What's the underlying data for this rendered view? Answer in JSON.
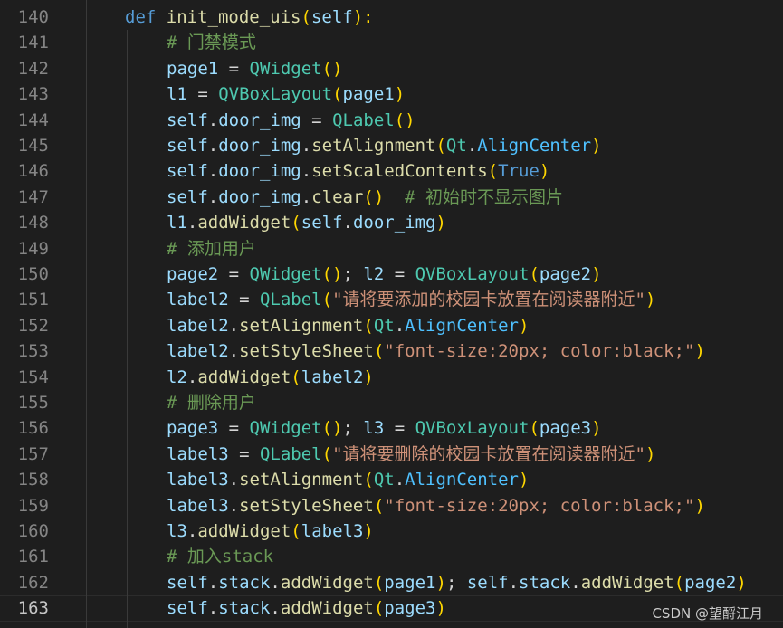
{
  "editor": {
    "watermark": "CSDN @望酹江月",
    "current_line": 163,
    "lines": [
      {
        "n": 140,
        "tokens": [
          [
            "kw",
            "def "
          ],
          [
            "fn",
            "init_mode_uis"
          ],
          [
            "pr",
            "("
          ],
          [
            "var",
            "self"
          ],
          [
            "pr",
            "):"
          ]
        ]
      },
      {
        "n": 141,
        "tokens": [
          [
            "cm",
            "# 门禁模式"
          ]
        ]
      },
      {
        "n": 142,
        "tokens": [
          [
            "var",
            "page1"
          ],
          [
            "pl",
            " = "
          ],
          [
            "cls",
            "QWidget"
          ],
          [
            "pr",
            "()"
          ]
        ]
      },
      {
        "n": 143,
        "tokens": [
          [
            "var",
            "l1"
          ],
          [
            "pl",
            " = "
          ],
          [
            "cls",
            "QVBoxLayout"
          ],
          [
            "pr",
            "("
          ],
          [
            "var",
            "page1"
          ],
          [
            "pr",
            ")"
          ]
        ]
      },
      {
        "n": 144,
        "tokens": [
          [
            "var",
            "self"
          ],
          [
            "pl",
            "."
          ],
          [
            "var",
            "door_img"
          ],
          [
            "pl",
            " = "
          ],
          [
            "cls",
            "QLabel"
          ],
          [
            "pr",
            "()"
          ]
        ]
      },
      {
        "n": 145,
        "tokens": [
          [
            "var",
            "self"
          ],
          [
            "pl",
            "."
          ],
          [
            "var",
            "door_img"
          ],
          [
            "pl",
            "."
          ],
          [
            "fn",
            "setAlignment"
          ],
          [
            "pr",
            "("
          ],
          [
            "cls",
            "Qt"
          ],
          [
            "pl",
            "."
          ],
          [
            "cn",
            "AlignCenter"
          ],
          [
            "pr",
            ")"
          ]
        ]
      },
      {
        "n": 146,
        "tokens": [
          [
            "var",
            "self"
          ],
          [
            "pl",
            "."
          ],
          [
            "var",
            "door_img"
          ],
          [
            "pl",
            "."
          ],
          [
            "fn",
            "setScaledContents"
          ],
          [
            "pr",
            "("
          ],
          [
            "const",
            "True"
          ],
          [
            "pr",
            ")"
          ]
        ]
      },
      {
        "n": 147,
        "tokens": [
          [
            "var",
            "self"
          ],
          [
            "pl",
            "."
          ],
          [
            "var",
            "door_img"
          ],
          [
            "pl",
            "."
          ],
          [
            "fn",
            "clear"
          ],
          [
            "pr",
            "()"
          ],
          [
            "pl",
            "  "
          ],
          [
            "cm",
            "# 初始时不显示图片"
          ]
        ]
      },
      {
        "n": 148,
        "tokens": [
          [
            "var",
            "l1"
          ],
          [
            "pl",
            "."
          ],
          [
            "fn",
            "addWidget"
          ],
          [
            "pr",
            "("
          ],
          [
            "var",
            "self"
          ],
          [
            "pl",
            "."
          ],
          [
            "var",
            "door_img"
          ],
          [
            "pr",
            ")"
          ]
        ]
      },
      {
        "n": 149,
        "tokens": [
          [
            "cm",
            "# 添加用户"
          ]
        ]
      },
      {
        "n": 150,
        "tokens": [
          [
            "var",
            "page2"
          ],
          [
            "pl",
            " = "
          ],
          [
            "cls",
            "QWidget"
          ],
          [
            "pr",
            "()"
          ],
          [
            "pl",
            "; "
          ],
          [
            "var",
            "l2"
          ],
          [
            "pl",
            " = "
          ],
          [
            "cls",
            "QVBoxLayout"
          ],
          [
            "pr",
            "("
          ],
          [
            "var",
            "page2"
          ],
          [
            "pr",
            ")"
          ]
        ]
      },
      {
        "n": 151,
        "tokens": [
          [
            "var",
            "label2"
          ],
          [
            "pl",
            " = "
          ],
          [
            "cls",
            "QLabel"
          ],
          [
            "pr",
            "("
          ],
          [
            "str",
            "\"请将要添加的校园卡放置在阅读器附近\""
          ],
          [
            "pr",
            ")"
          ]
        ]
      },
      {
        "n": 152,
        "tokens": [
          [
            "var",
            "label2"
          ],
          [
            "pl",
            "."
          ],
          [
            "fn",
            "setAlignment"
          ],
          [
            "pr",
            "("
          ],
          [
            "cls",
            "Qt"
          ],
          [
            "pl",
            "."
          ],
          [
            "cn",
            "AlignCenter"
          ],
          [
            "pr",
            ")"
          ]
        ]
      },
      {
        "n": 153,
        "tokens": [
          [
            "var",
            "label2"
          ],
          [
            "pl",
            "."
          ],
          [
            "fn",
            "setStyleSheet"
          ],
          [
            "pr",
            "("
          ],
          [
            "str",
            "\"font-size:20px; color:black;\""
          ],
          [
            "pr",
            ")"
          ]
        ]
      },
      {
        "n": 154,
        "tokens": [
          [
            "var",
            "l2"
          ],
          [
            "pl",
            "."
          ],
          [
            "fn",
            "addWidget"
          ],
          [
            "pr",
            "("
          ],
          [
            "var",
            "label2"
          ],
          [
            "pr",
            ")"
          ]
        ]
      },
      {
        "n": 155,
        "tokens": [
          [
            "cm",
            "# 删除用户"
          ]
        ]
      },
      {
        "n": 156,
        "tokens": [
          [
            "var",
            "page3"
          ],
          [
            "pl",
            " = "
          ],
          [
            "cls",
            "QWidget"
          ],
          [
            "pr",
            "()"
          ],
          [
            "pl",
            "; "
          ],
          [
            "var",
            "l3"
          ],
          [
            "pl",
            " = "
          ],
          [
            "cls",
            "QVBoxLayout"
          ],
          [
            "pr",
            "("
          ],
          [
            "var",
            "page3"
          ],
          [
            "pr",
            ")"
          ]
        ]
      },
      {
        "n": 157,
        "tokens": [
          [
            "var",
            "label3"
          ],
          [
            "pl",
            " = "
          ],
          [
            "cls",
            "QLabel"
          ],
          [
            "pr",
            "("
          ],
          [
            "str",
            "\"请将要删除的校园卡放置在阅读器附近\""
          ],
          [
            "pr",
            ")"
          ]
        ]
      },
      {
        "n": 158,
        "tokens": [
          [
            "var",
            "label3"
          ],
          [
            "pl",
            "."
          ],
          [
            "fn",
            "setAlignment"
          ],
          [
            "pr",
            "("
          ],
          [
            "cls",
            "Qt"
          ],
          [
            "pl",
            "."
          ],
          [
            "cn",
            "AlignCenter"
          ],
          [
            "pr",
            ")"
          ]
        ]
      },
      {
        "n": 159,
        "tokens": [
          [
            "var",
            "label3"
          ],
          [
            "pl",
            "."
          ],
          [
            "fn",
            "setStyleSheet"
          ],
          [
            "pr",
            "("
          ],
          [
            "str",
            "\"font-size:20px; color:black;\""
          ],
          [
            "pr",
            ")"
          ]
        ]
      },
      {
        "n": 160,
        "tokens": [
          [
            "var",
            "l3"
          ],
          [
            "pl",
            "."
          ],
          [
            "fn",
            "addWidget"
          ],
          [
            "pr",
            "("
          ],
          [
            "var",
            "label3"
          ],
          [
            "pr",
            ")"
          ]
        ]
      },
      {
        "n": 161,
        "tokens": [
          [
            "cm",
            "# 加入stack"
          ]
        ]
      },
      {
        "n": 162,
        "tokens": [
          [
            "var",
            "self"
          ],
          [
            "pl",
            "."
          ],
          [
            "var",
            "stack"
          ],
          [
            "pl",
            "."
          ],
          [
            "fn",
            "addWidget"
          ],
          [
            "pr",
            "("
          ],
          [
            "var",
            "page1"
          ],
          [
            "pr",
            ")"
          ],
          [
            "pl",
            "; "
          ],
          [
            "var",
            "self"
          ],
          [
            "pl",
            "."
          ],
          [
            "var",
            "stack"
          ],
          [
            "pl",
            "."
          ],
          [
            "fn",
            "addWidget"
          ],
          [
            "pr",
            "("
          ],
          [
            "var",
            "page2"
          ],
          [
            "pr",
            ")"
          ]
        ]
      },
      {
        "n": 163,
        "tokens": [
          [
            "var",
            "self"
          ],
          [
            "pl",
            "."
          ],
          [
            "var",
            "stack"
          ],
          [
            "pl",
            "."
          ],
          [
            "fn",
            "addWidget"
          ],
          [
            "pr",
            "("
          ],
          [
            "var",
            "page3"
          ],
          [
            "pr",
            ")"
          ]
        ]
      }
    ]
  }
}
